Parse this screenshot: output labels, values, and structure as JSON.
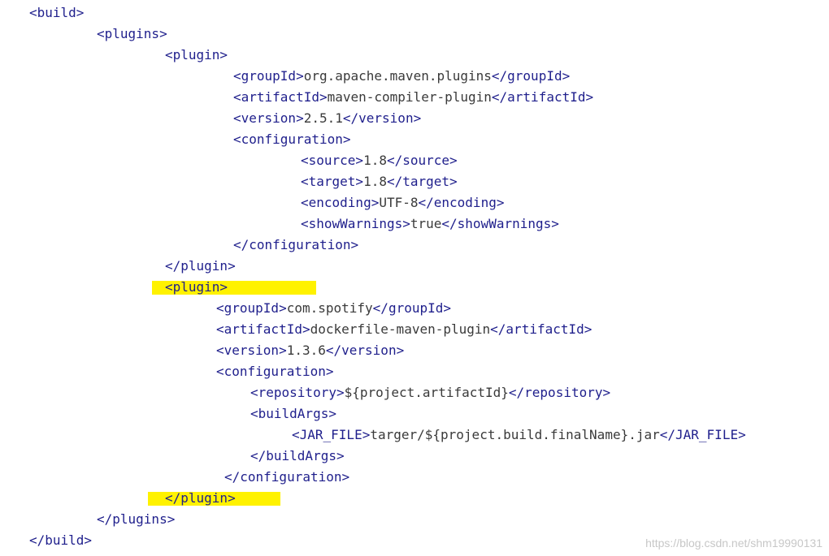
{
  "highlight_color": "#fff200",
  "tag_color": "#1f1f8c",
  "text_color": "#3a3a3a",
  "lines": [
    {
      "tag_open": "<build>",
      "text": "",
      "tag_close": ""
    },
    {
      "tag_open": "<plugins>",
      "text": "",
      "tag_close": ""
    },
    {
      "tag_open": "<plugin>",
      "text": "",
      "tag_close": ""
    },
    {
      "tag_open": "<groupId>",
      "text": "org.apache.maven.plugins",
      "tag_close": "</groupId>"
    },
    {
      "tag_open": "<artifactId>",
      "text": "maven-compiler-plugin",
      "tag_close": "</artifactId>"
    },
    {
      "tag_open": "<version>",
      "text": "2.5.1",
      "tag_close": "</version>"
    },
    {
      "tag_open": "<configuration>",
      "text": "",
      "tag_close": ""
    },
    {
      "tag_open": "<source>",
      "text": "1.8",
      "tag_close": "</source>"
    },
    {
      "tag_open": "<target>",
      "text": "1.8",
      "tag_close": "</target>"
    },
    {
      "tag_open": "<encoding>",
      "text": "UTF-8",
      "tag_close": "</encoding>"
    },
    {
      "tag_open": "<showWarnings>",
      "text": "true",
      "tag_close": "</showWarnings>"
    },
    {
      "tag_open": "</configuration>",
      "text": "",
      "tag_close": ""
    },
    {
      "tag_open": "</plugin>",
      "text": "",
      "tag_close": ""
    },
    {
      "tag_open": "<plugin>",
      "text": "",
      "tag_close": ""
    },
    {
      "tag_open": "<groupId>",
      "text": "com.spotify",
      "tag_close": "</groupId>"
    },
    {
      "tag_open": "<artifactId>",
      "text": "dockerfile-maven-plugin",
      "tag_close": "</artifactId>"
    },
    {
      "tag_open": "<version>",
      "text": "1.3.6",
      "tag_close": "</version>"
    },
    {
      "tag_open": "<configuration>",
      "text": "",
      "tag_close": ""
    },
    {
      "tag_open": "<repository>",
      "text": "${project.artifactId}",
      "tag_close": "</repository>"
    },
    {
      "tag_open": "<buildArgs>",
      "text": "",
      "tag_close": ""
    },
    {
      "tag_open": "<JAR_FILE>",
      "text": "targer/${project.build.finalName}.jar",
      "tag_close": "</JAR_FILE>"
    },
    {
      "tag_open": "</buildArgs>",
      "text": "",
      "tag_close": ""
    },
    {
      "tag_open": "</configuration>",
      "text": "",
      "tag_close": ""
    },
    {
      "tag_open": "</plugin>",
      "text": "",
      "tag_close": ""
    },
    {
      "tag_open": "</plugins>",
      "text": "",
      "tag_close": ""
    },
    {
      "tag_open": "</build>",
      "text": "",
      "tag_close": ""
    }
  ],
  "watermark": "https://blog.csdn.net/shm19990131"
}
